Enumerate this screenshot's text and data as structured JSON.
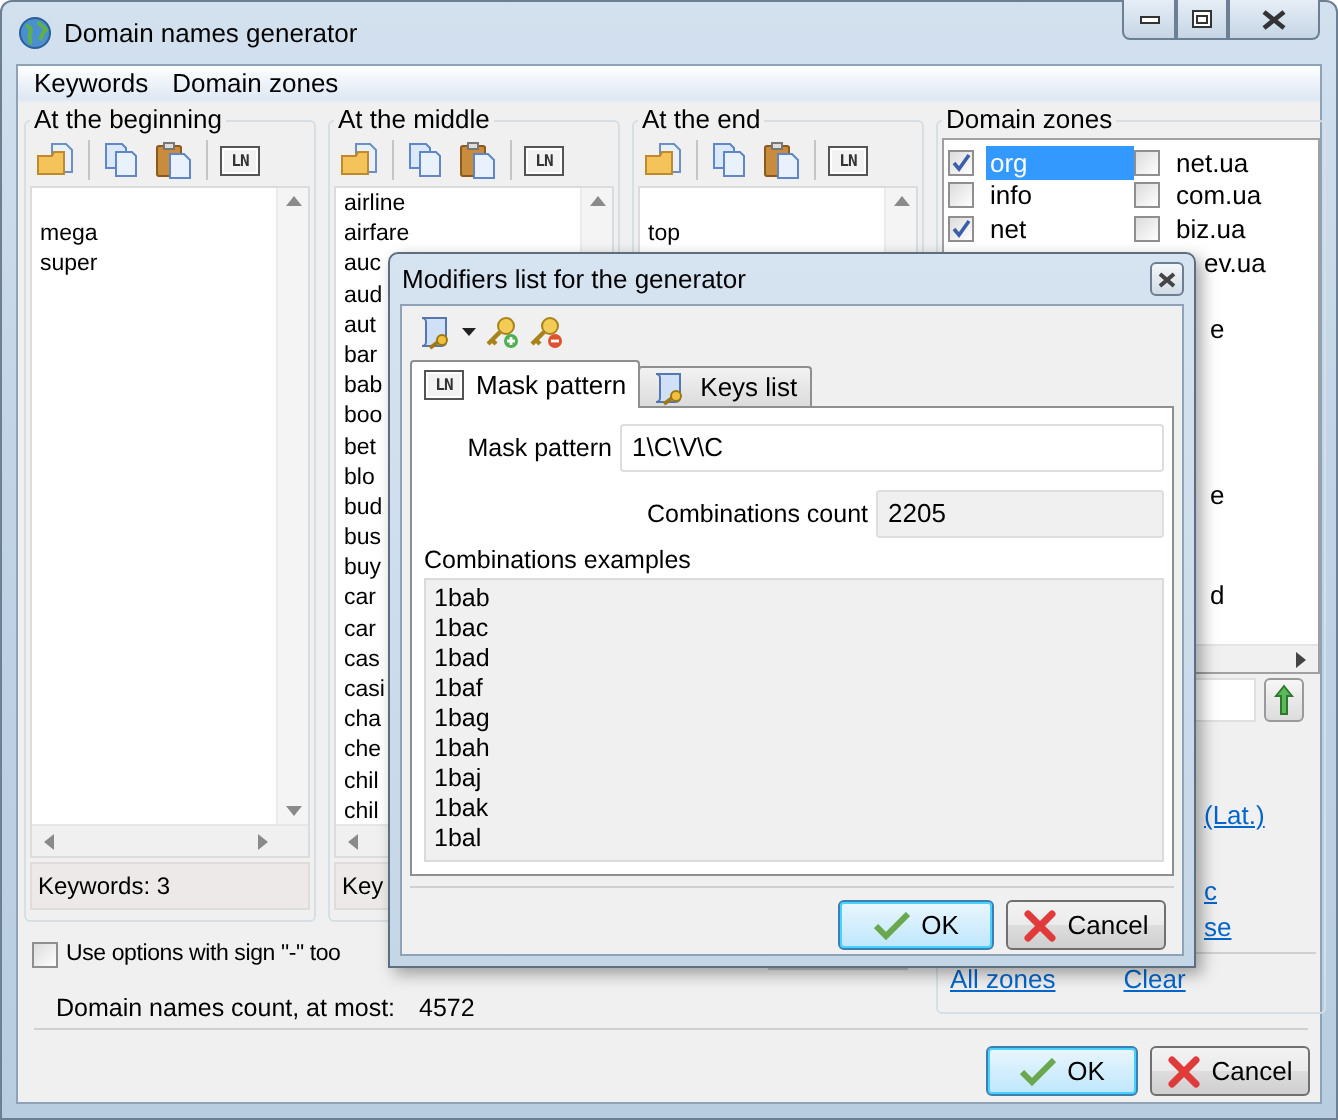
{
  "window": {
    "title": "Domain names generator"
  },
  "menu": [
    "Keywords",
    "Domain zones"
  ],
  "columns": [
    {
      "title": "At the beginning",
      "ln_badge": "LN",
      "blank_first_line": true,
      "items": [
        "mega",
        "super"
      ],
      "status": "Keywords: 3"
    },
    {
      "title": "At the middle",
      "ln_badge": "LN",
      "blank_first_line": false,
      "items": [
        "airline",
        "airfare",
        "auc",
        "aud",
        "aut",
        "bar",
        "bab",
        "boo",
        "bet",
        "blo",
        "bud",
        "bus",
        "buy",
        "car",
        "car",
        "cas",
        "casi",
        "cha",
        "che",
        "chil",
        "chil"
      ],
      "status": "Key"
    },
    {
      "title": "At the end",
      "ln_badge": "LN",
      "blank_first_line": true,
      "items": [
        "top"
      ]
    }
  ],
  "use_minus_option": {
    "label": "Use options with sign \"-\" too",
    "checked": false
  },
  "count": {
    "label": "Domain names count, at most:",
    "value": "4572"
  },
  "domain_zones": {
    "title": "Domain zones",
    "left": [
      {
        "kind": "zone",
        "label": "org",
        "checked": true,
        "selected": true
      },
      {
        "kind": "zone",
        "label": "info",
        "checked": false,
        "selected": false
      },
      {
        "kind": "zone",
        "label": "net",
        "checked": true,
        "selected": false
      }
    ],
    "right": [
      {
        "kind": "zone",
        "label": "net.ua",
        "checked": false,
        "selected": false
      },
      {
        "kind": "zone",
        "label": "com.ua",
        "checked": false,
        "selected": false
      },
      {
        "kind": "zone",
        "label": "biz.ua",
        "checked": false,
        "selected": false
      },
      {
        "kind": "cut",
        "label": "ev.ua"
      },
      {
        "kind": "hidden"
      },
      {
        "kind": "cut",
        "label": "e"
      },
      {
        "kind": "hidden"
      },
      {
        "kind": "hidden"
      },
      {
        "kind": "hidden"
      },
      {
        "kind": "hidden"
      },
      {
        "kind": "cut",
        "label": "e"
      },
      {
        "kind": "hidden"
      },
      {
        "kind": "hidden"
      },
      {
        "kind": "cut",
        "label": "d"
      }
    ],
    "links": [
      "(Lat.)",
      "c",
      "se"
    ],
    "bottom_links": [
      "All zones",
      "Clear"
    ]
  },
  "buttons": {
    "ok": "OK",
    "cancel": "Cancel"
  },
  "dialog": {
    "title": "Modifiers list for the generator",
    "tabs": [
      {
        "label": "Mask pattern",
        "kind": "badge",
        "ln_badge": "LN",
        "selected": true
      },
      {
        "label": "Keys list",
        "kind": "script",
        "selected": false
      }
    ],
    "mask_label": "Mask pattern",
    "mask_value": "1\\C\\V\\C",
    "count_label": "Combinations count",
    "count_value": "2205",
    "examples_label": "Combinations examples",
    "examples": [
      "1bab",
      "1bac",
      "1bad",
      "1baf",
      "1bag",
      "1bah",
      "1baj",
      "1bak",
      "1bal"
    ],
    "ok": "OK",
    "cancel": "Cancel"
  }
}
